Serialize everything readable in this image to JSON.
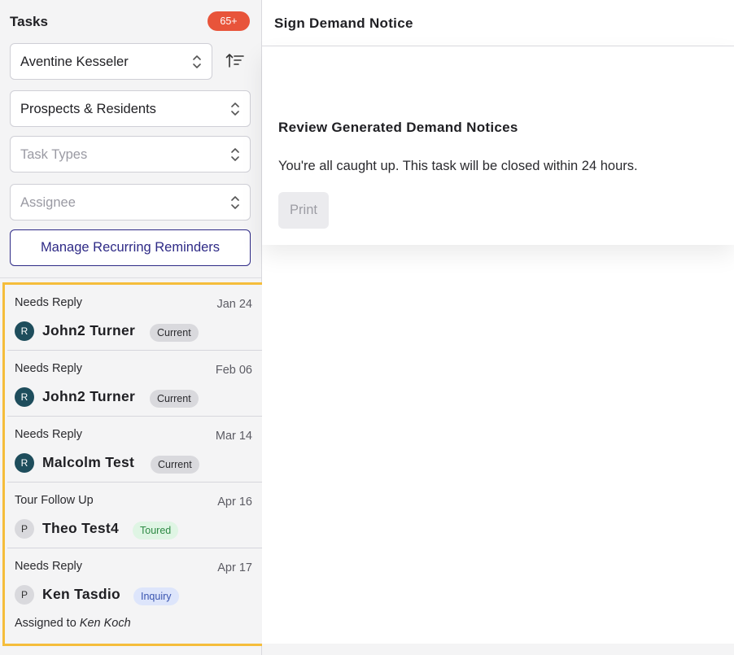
{
  "sidebar": {
    "title": "Tasks",
    "count_badge": "65+",
    "filters": {
      "property": {
        "value": "Aventine Kesseler"
      },
      "audience": {
        "value": "Prospects & Residents"
      },
      "task_types": {
        "placeholder": "Task Types"
      },
      "assignee": {
        "placeholder": "Assignee"
      }
    },
    "manage_button_label": "Manage Recurring Reminders",
    "tasks": [
      {
        "type": "Needs Reply",
        "date": "Jan 24",
        "avatar_letter": "R",
        "name": "John2 Turner",
        "status": "Current"
      },
      {
        "type": "Needs Reply",
        "date": "Feb 06",
        "avatar_letter": "R",
        "name": "John2 Turner",
        "status": "Current"
      },
      {
        "type": "Needs Reply",
        "date": "Mar 14",
        "avatar_letter": "R",
        "name": "Malcolm Test",
        "status": "Current"
      },
      {
        "type": "Tour Follow Up",
        "date": "Apr 16",
        "avatar_letter": "P",
        "name": "Theo Test4",
        "status": "Toured"
      },
      {
        "type": "Needs Reply",
        "date": "Apr 17",
        "avatar_letter": "P",
        "name": "Ken Tasdio",
        "status": "Inquiry",
        "assigned_prefix": "Assigned to",
        "assigned_name": "Ken Koch"
      }
    ]
  },
  "main": {
    "title": "Sign Demand Notice",
    "card": {
      "title": "Review Generated Demand Notices",
      "message": "You're all caught up. This task will be closed within 24 hours.",
      "print_label": "Print"
    }
  },
  "colors": {
    "accent": "#2e2a86",
    "badge": "#e8543a",
    "highlight_border": "#f5bd3b",
    "resident_avatar": "#1e4d5c"
  }
}
